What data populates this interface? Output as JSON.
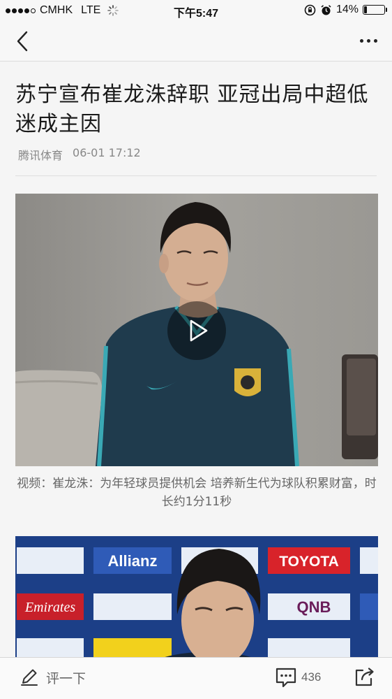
{
  "status_bar": {
    "carrier": "CMHK",
    "network": "LTE",
    "time": "下午5:47",
    "battery": "14%",
    "battery_level": 0.14
  },
  "nav": {
    "back_icon": "chevron-left-icon",
    "more_icon": "more-dots-icon"
  },
  "article": {
    "title": "苏宁宣布崔龙洙辞职 亚冠出局中超低迷成主因",
    "source": "腾讯体育",
    "date": "06-01 17:12",
    "video_caption": "视频：崔龙洙：为年轻球员提供机会 培养新生代为球队积累财富，时长约1分11秒",
    "photo_sponsors": [
      "Allianz",
      "TOYOTA",
      "Emirates",
      "QNB"
    ]
  },
  "bottom_bar": {
    "comment_placeholder": "评一下",
    "comment_count": "436"
  }
}
